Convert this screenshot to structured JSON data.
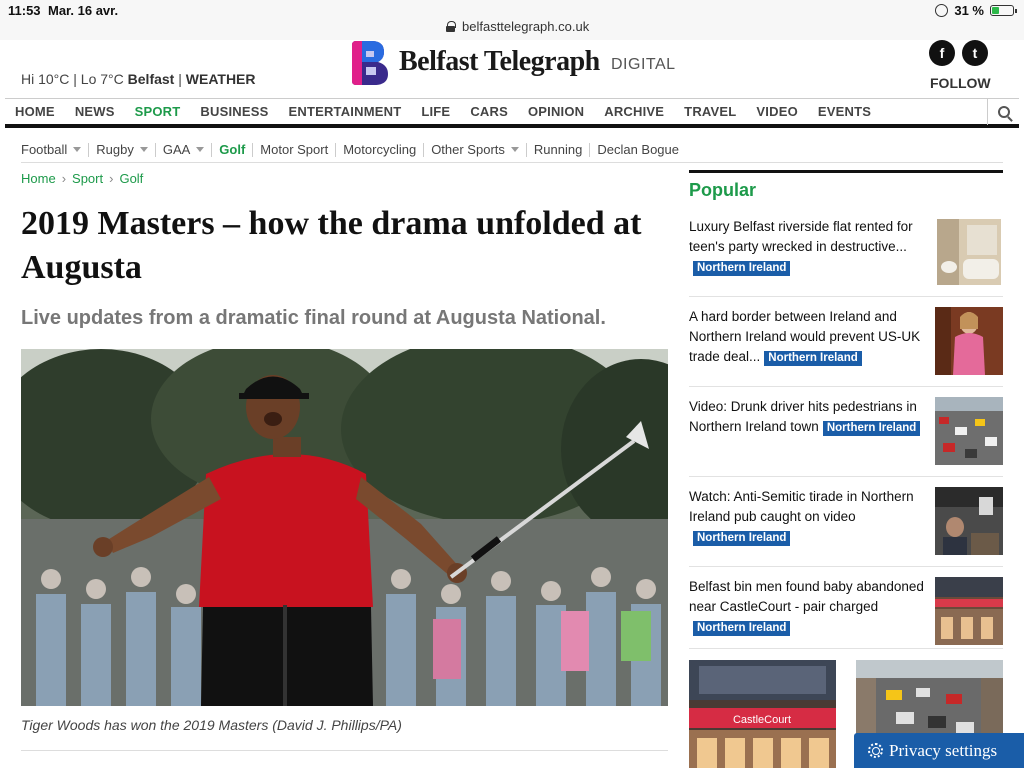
{
  "status_bar": {
    "time": "11:53",
    "date": "Mar. 16 avr.",
    "url": "belfasttelegraph.co.uk",
    "battery": "31 %"
  },
  "header": {
    "weather_temps": "Hi 10°C | Lo 7°C",
    "weather_city": "Belfast",
    "weather_sep": "|",
    "weather_link": "WEATHER",
    "logo_text": "Belfast Telegraph",
    "logo_suffix": "DIGITAL",
    "facebook_glyph": "f",
    "twitter_glyph": "t",
    "follow_label": "FOLLOW"
  },
  "main_nav": [
    {
      "label": "HOME",
      "active": false
    },
    {
      "label": "NEWS",
      "active": false
    },
    {
      "label": "SPORT",
      "active": true
    },
    {
      "label": "BUSINESS",
      "active": false
    },
    {
      "label": "ENTERTAINMENT",
      "active": false
    },
    {
      "label": "LIFE",
      "active": false
    },
    {
      "label": "CARS",
      "active": false
    },
    {
      "label": "OPINION",
      "active": false
    },
    {
      "label": "ARCHIVE",
      "active": false
    },
    {
      "label": "TRAVEL",
      "active": false
    },
    {
      "label": "VIDEO",
      "active": false
    },
    {
      "label": "EVENTS",
      "active": false
    }
  ],
  "sub_nav": [
    {
      "label": "Football"
    },
    {
      "label": "Rugby"
    },
    {
      "label": "GAA"
    },
    {
      "label": "Golf"
    },
    {
      "label": "Motor Sport"
    },
    {
      "label": "Motorcycling"
    },
    {
      "label": "Other Sports"
    },
    {
      "label": "Running"
    },
    {
      "label": "Declan Bogue"
    }
  ],
  "breadcrumb": {
    "home": "Home",
    "sport": "Sport",
    "golf": "Golf",
    "separator": "›"
  },
  "article": {
    "headline": "2019 Masters – how the drama unfolded at Augusta",
    "subhead": "Live updates from a dramatic final round at Augusta National.",
    "caption": "Tiger Woods has won the 2019 Masters (David J. Phillips/PA)"
  },
  "popular": {
    "title": "Popular",
    "items": [
      {
        "text": "Luxury Belfast riverside flat rented for teen's party wrecked in destructive...",
        "tag": "Northern Ireland"
      },
      {
        "text": "A hard border between Ireland and Northern Ireland would prevent US-UK trade deal...",
        "tag": "Northern Ireland"
      },
      {
        "text": "Video: Drunk driver hits pedestrians in Northern Ireland town",
        "tag": "Northern Ireland"
      },
      {
        "text": "Watch: Anti-Semitic tirade in Northern Ireland pub caught on video",
        "tag": "Northern Ireland"
      },
      {
        "text": "Belfast bin men found baby abandoned near CastleCourt - pair charged",
        "tag": "Northern Ireland"
      }
    ],
    "castlecourt_sign": "CastleCourt"
  },
  "privacy_label": "Privacy settings",
  "colors": {
    "brand_green": "#1d9a4a",
    "tag_blue": "#1a5da8"
  }
}
